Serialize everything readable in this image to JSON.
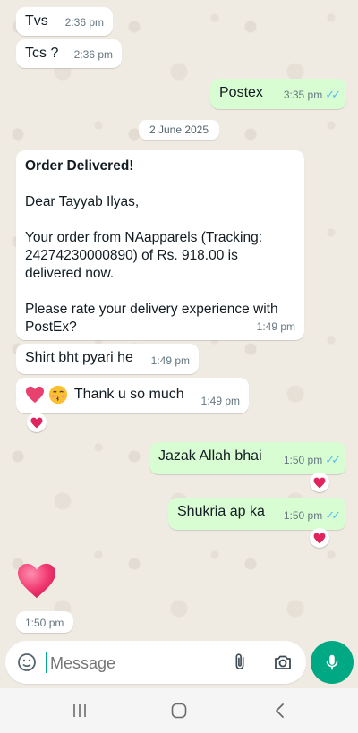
{
  "messages": [
    {
      "text": "Tvs",
      "time": "2:36 pm"
    },
    {
      "text": "Tcs ?",
      "time": "2:36 pm"
    },
    {
      "text": "Postex",
      "time": "3:35 pm"
    },
    {
      "title": "Order Delivered!",
      "greeting": "Dear Tayyab Ilyas,",
      "body1": "Your order from NAapparels (Tracking: 24274230000890) of Rs. 918.00 is delivered now.",
      "body2": "Please rate your delivery experience with PostEx?",
      "time": "1:49 pm"
    },
    {
      "text": "Shirt bht pyari he",
      "time": "1:49 pm"
    },
    {
      "text": "Thank u so much",
      "time": "1:49 pm"
    },
    {
      "text": "Jazak Allah bhai",
      "time": "1:50 pm"
    },
    {
      "text": "Shukria ap ka",
      "time": "1:50 pm"
    },
    {
      "time": "1:50 pm"
    }
  ],
  "date_separator": "2 June 2025",
  "composer": {
    "placeholder": "Message"
  },
  "colors": {
    "incoming": "#ffffff",
    "outgoing": "#d9fdd3",
    "accent": "#00a884",
    "read_ticks": "#53bdeb",
    "heart": "#e8416f"
  },
  "icons": [
    "sticker-icon",
    "attach-icon",
    "camera-icon",
    "mic-icon",
    "heart-icon",
    "kiss-emoji-icon",
    "recents-icon",
    "home-icon",
    "back-icon"
  ]
}
